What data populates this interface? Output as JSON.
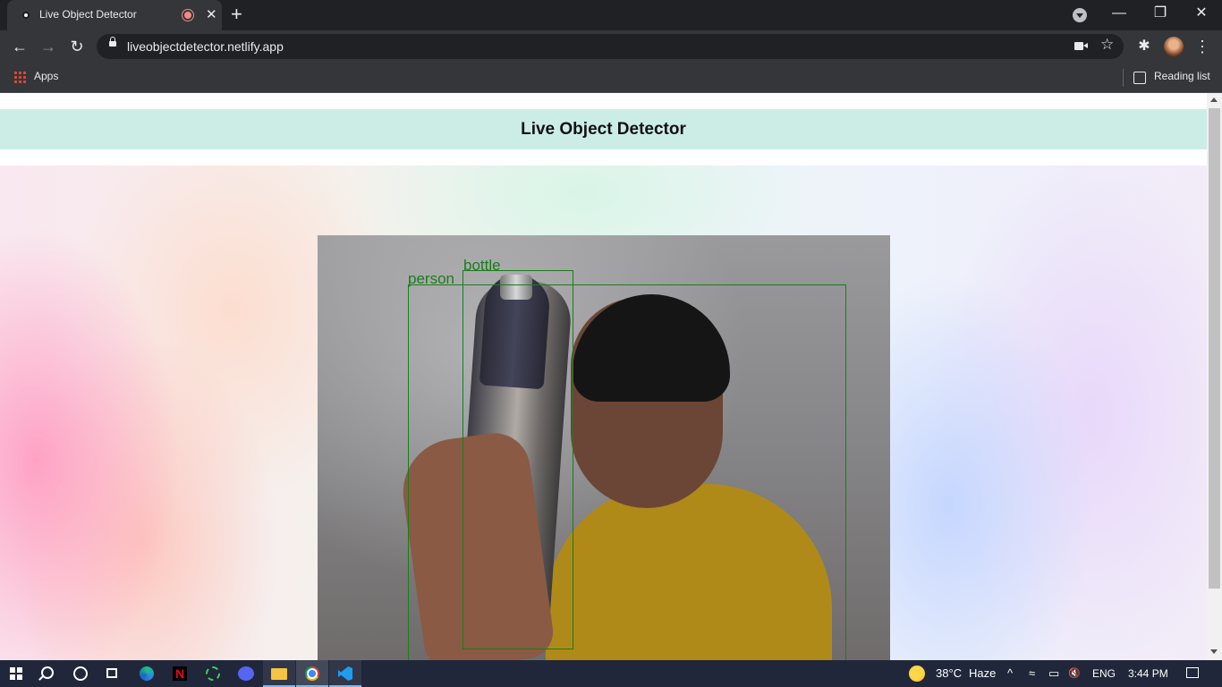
{
  "browser": {
    "tab_title": "Live Object Detector",
    "tab_close": "✕",
    "new_tab": "+",
    "url": "liveobjectdetector.netlify.app",
    "window_controls": {
      "minimize": "—",
      "restore": "❐",
      "close": "✕"
    },
    "nav_icons": {
      "back": "←",
      "forward": "→",
      "reload": "↻",
      "star": "☆",
      "extensions": "✱",
      "menu": "⋮"
    },
    "bookmarks": {
      "apps_label": "Apps",
      "reading_list_label": "Reading list"
    }
  },
  "page": {
    "title": "Live Object Detector",
    "detections": [
      {
        "label": "person"
      },
      {
        "label": "bottle"
      }
    ]
  },
  "taskbar": {
    "weather_temp": "38°C",
    "weather_desc": "Haze",
    "language": "ENG",
    "time": "3:44 PM",
    "tray_icons": {
      "chevron": "^",
      "wifi": "≈",
      "battery": "▭",
      "volume": "🔇"
    }
  },
  "colors": {
    "detection_box": "#1a7d1a",
    "header_band": "#ccede6",
    "chrome_dark": "#202124",
    "taskbar": "#20273a"
  }
}
